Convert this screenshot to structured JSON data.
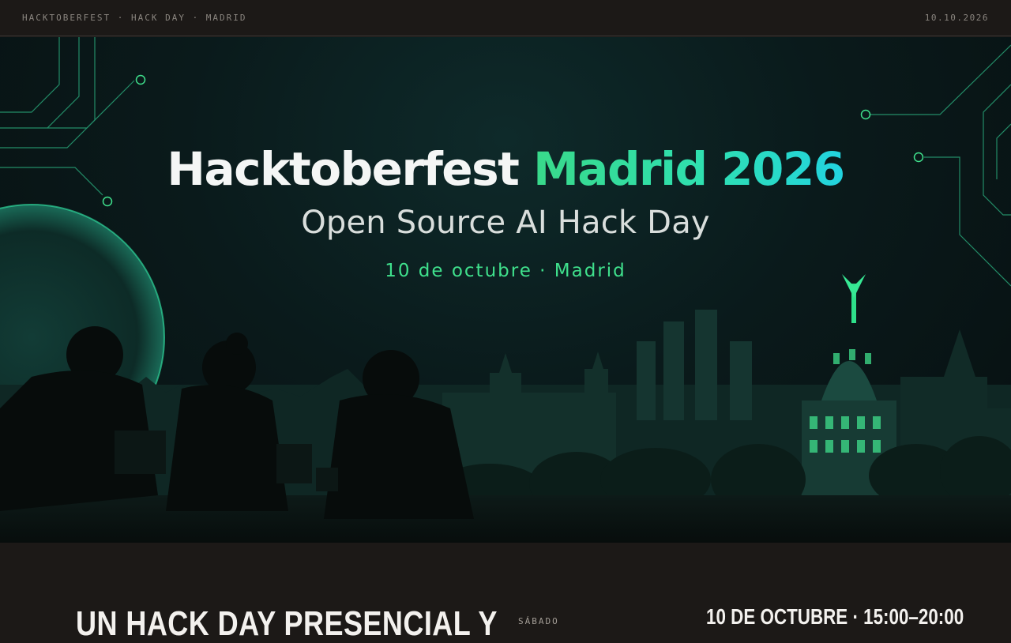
{
  "topbar": {
    "brand": "HACKTOBERFEST · HACK DAY · MADRID",
    "date": "10.10.2026"
  },
  "hero": {
    "title_part1": "Hacktoberfest",
    "title_part2": "Madrid 2026",
    "subtitle": "Open Source AI Hack Day",
    "date_line": "10 de octubre · Madrid",
    "image_description_icon": "madrid-skyline-illustration"
  },
  "info": {
    "heading": "UN HACK DAY PRESENCIAL Y",
    "day_label": "SÁBADO",
    "when": "10 DE OCTUBRE · 15:00–20:00"
  },
  "colors": {
    "background": "#1c1917",
    "accent_green": "#3fe08c",
    "accent_cyan": "#22d3e0",
    "hero_bg": "#0a1a1b"
  }
}
